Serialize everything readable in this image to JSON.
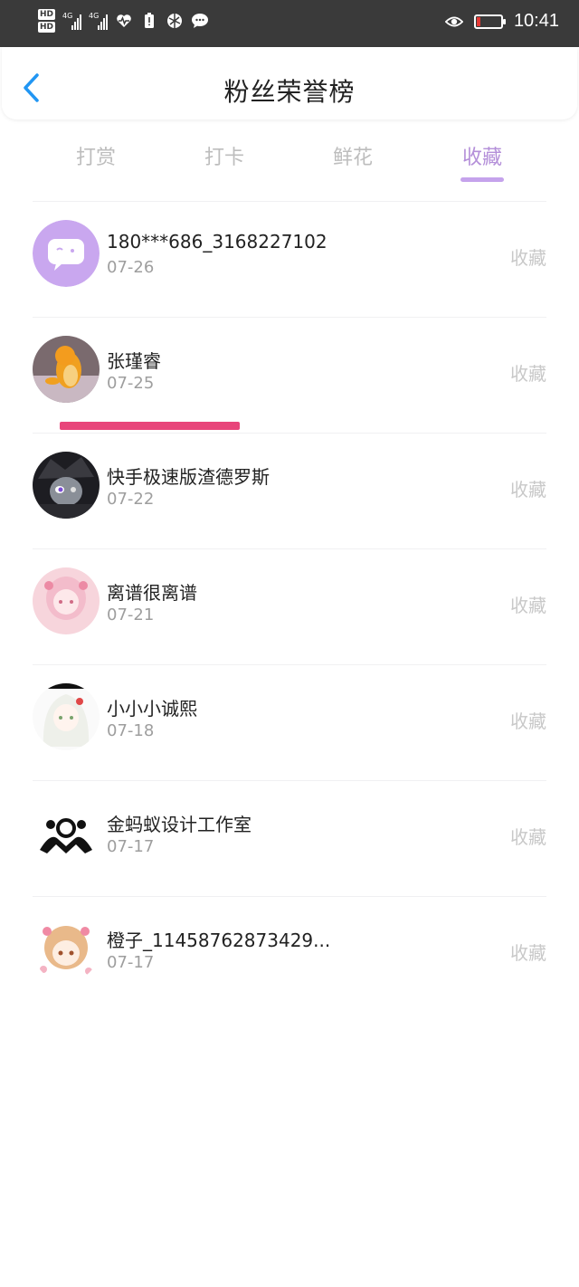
{
  "status_bar": {
    "time": "10:41",
    "hd1": "HD",
    "hd2": "HD",
    "net1": "4G",
    "net2": "4G"
  },
  "header": {
    "title": "粉丝荣誉榜"
  },
  "tabs": [
    {
      "label": "打赏"
    },
    {
      "label": "打卡"
    },
    {
      "label": "鲜花"
    },
    {
      "label": "收藏"
    }
  ],
  "active_tab": "收藏",
  "colors": {
    "accent": "#b48fd9",
    "underline": "#c5a3ec",
    "highlight": "#e8457a"
  },
  "fans": [
    {
      "name": "180***686_3168227102",
      "date": "07-26",
      "action": "收藏",
      "avatar": "chat-bubble-avatar"
    },
    {
      "name": "张瑾睿",
      "date": "07-25",
      "action": "收藏",
      "avatar": "charmander-avatar"
    },
    {
      "name": "快手极速版渣德罗斯",
      "date": "07-22",
      "action": "收藏",
      "avatar": "dark-character-avatar"
    },
    {
      "name": "离谱很离谱",
      "date": "07-21",
      "action": "收藏",
      "avatar": "pink-anime-avatar"
    },
    {
      "name": "小小小诚熙",
      "date": "07-18",
      "action": "收藏",
      "avatar": "white-hair-anime-avatar"
    },
    {
      "name": "金蚂蚁设计工作室",
      "date": "07-17",
      "action": "收藏",
      "avatar": "black-white-sketch-avatar"
    },
    {
      "name": "橙子_11458762873429...",
      "date": "07-17",
      "action": "收藏",
      "avatar": "cute-anime-girl-avatar"
    }
  ]
}
